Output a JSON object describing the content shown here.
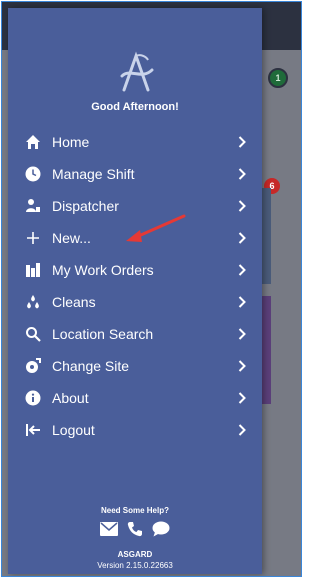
{
  "drawer": {
    "greeting": "Good Afternoon!",
    "logo_icon": "a-logo-icon",
    "items": [
      {
        "label": "Home",
        "icon": "home-icon"
      },
      {
        "label": "Manage Shift",
        "icon": "clock-icon"
      },
      {
        "label": "Dispatcher",
        "icon": "dispatcher-icon"
      },
      {
        "label": "New...",
        "icon": "plus-icon"
      },
      {
        "label": "My Work Orders",
        "icon": "work-orders-icon"
      },
      {
        "label": "Cleans",
        "icon": "droplets-icon"
      },
      {
        "label": "Location Search",
        "icon": "search-icon"
      },
      {
        "label": "Change Site",
        "icon": "change-site-icon"
      },
      {
        "label": "About",
        "icon": "info-icon"
      },
      {
        "label": "Logout",
        "icon": "logout-icon"
      }
    ],
    "footer": {
      "help_text": "Need Some Help?",
      "icons": [
        "email-icon",
        "phone-icon",
        "chat-icon"
      ],
      "app_name": "ASGARD",
      "version": "Version 2.15.0.22663"
    }
  },
  "background": {
    "badge_green": "1",
    "badge_red": "6"
  },
  "colors": {
    "drawer": "#4a5e9a",
    "text": "#ffffff",
    "arrow": "#e53935",
    "frame_border": "#3a86d9"
  }
}
